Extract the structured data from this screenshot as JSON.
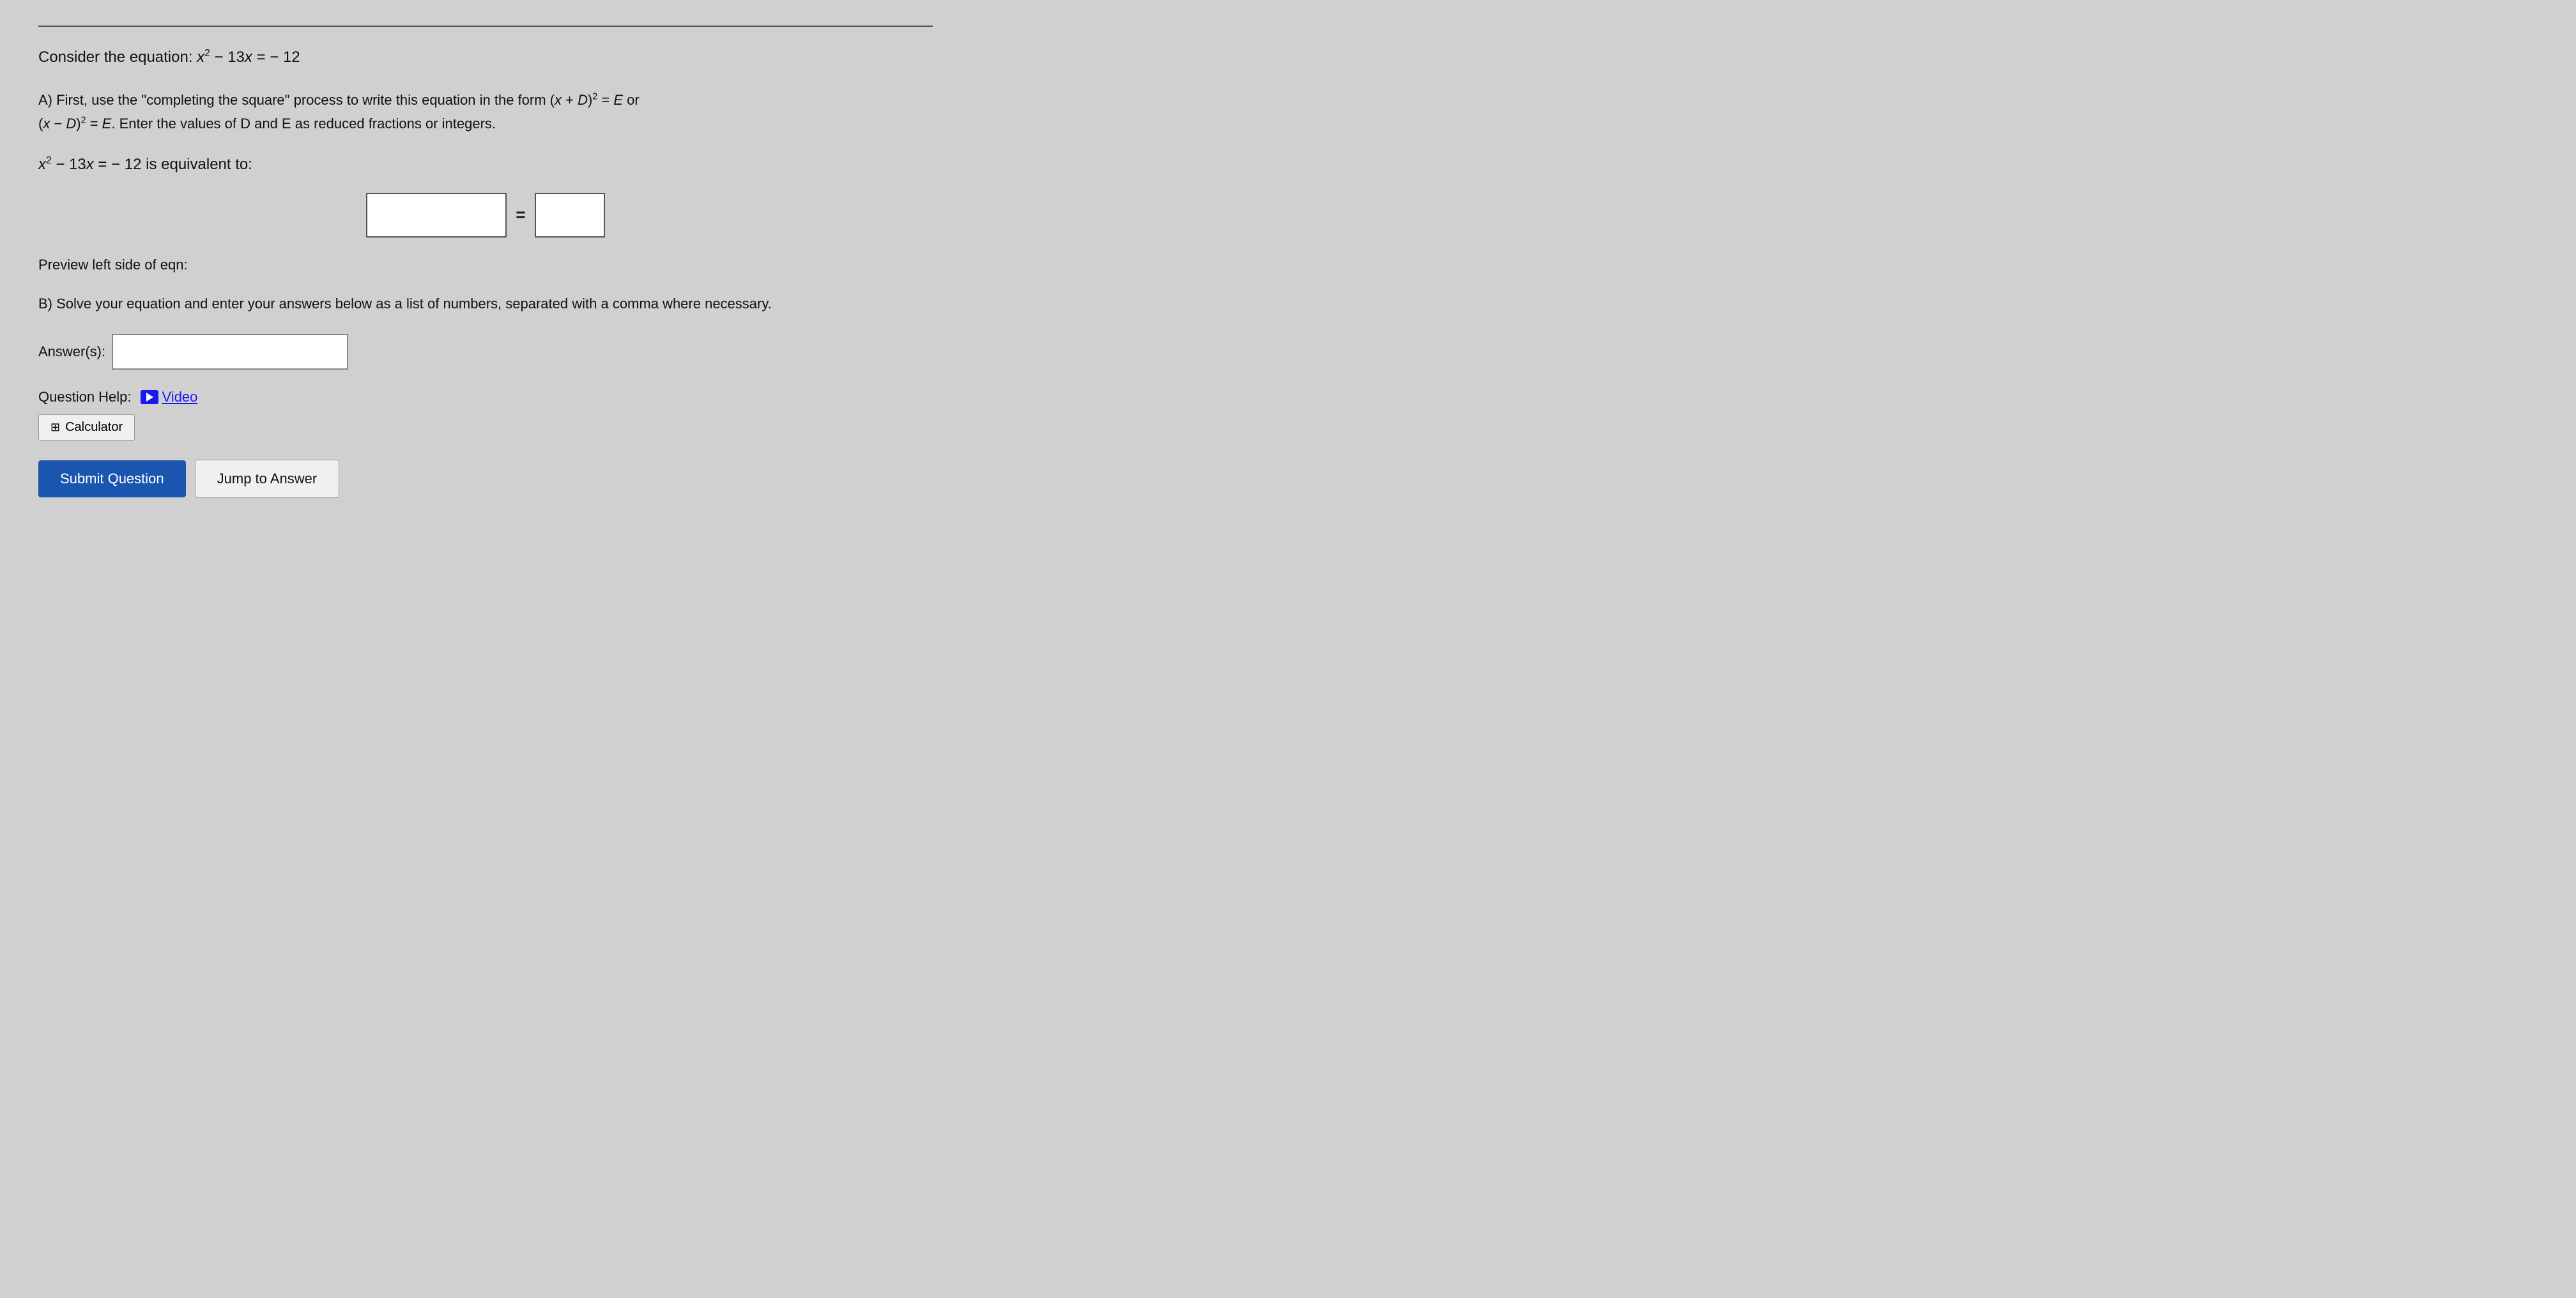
{
  "page": {
    "top_line": true,
    "equation_header": "Consider the equation: x² − 13x = − 12",
    "section_a": {
      "text": "A) First, use the \"completing the square\" process to write this equation in the form (x + D)² = E or (x − D)² = E. Enter the values of D and E as reduced fractions or integers."
    },
    "equation_line": "x² − 13x = − 12 is equivalent to:",
    "equals_sign": "=",
    "preview_text": "Preview left side of eqn:",
    "section_b": {
      "text": "B) Solve your equation and enter your answers below as a list of numbers, separated with a comma where necessary."
    },
    "answer_label": "Answer(s):",
    "question_help_label": "Question Help:",
    "video_link_text": "Video",
    "calculator_btn_label": "Calculator",
    "submit_btn_label": "Submit Question",
    "jump_btn_label": "Jump to Answer",
    "left_input_placeholder": "",
    "right_input_placeholder": "",
    "answer_input_placeholder": ""
  }
}
